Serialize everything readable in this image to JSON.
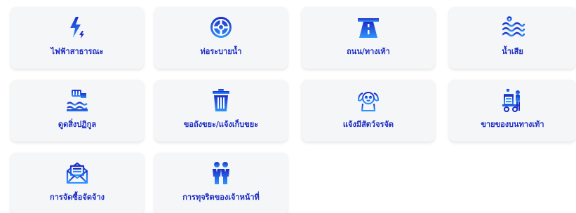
{
  "colors": {
    "tile_bg": "#f5f6f8",
    "label": "#1b2cc4",
    "icon_dark": "#1b2cc4",
    "icon_light": "#2f95ff"
  },
  "tiles": [
    {
      "label": "ไฟฟ้าสาธารณะ",
      "icon": "lightning-bolt-icon"
    },
    {
      "label": "ท่อระบายน้ำ",
      "icon": "drain-cover-icon"
    },
    {
      "label": "ถนน/ทางเท้า",
      "icon": "road-icon"
    },
    {
      "label": "น้ำเสีย",
      "icon": "wastewater-waves-icon"
    },
    {
      "label": "ดูดสิ่งปฏิกูล",
      "icon": "sewage-pipe-icon"
    },
    {
      "label": "ขอถังขยะ/แจ้งเก็บขยะ",
      "icon": "trash-bin-icon"
    },
    {
      "label": "แจ้งมีสัตว์จรจัด",
      "icon": "stray-dog-icon"
    },
    {
      "label": "ขายของบนทางเท้า",
      "icon": "street-vendor-cart-icon"
    },
    {
      "label": "การจัดซื้อจัดจ้าง",
      "icon": "mail-envelope-icon"
    },
    {
      "label": "การทุจริตของเจ้าหน้าที่",
      "icon": "officials-people-icon"
    }
  ]
}
